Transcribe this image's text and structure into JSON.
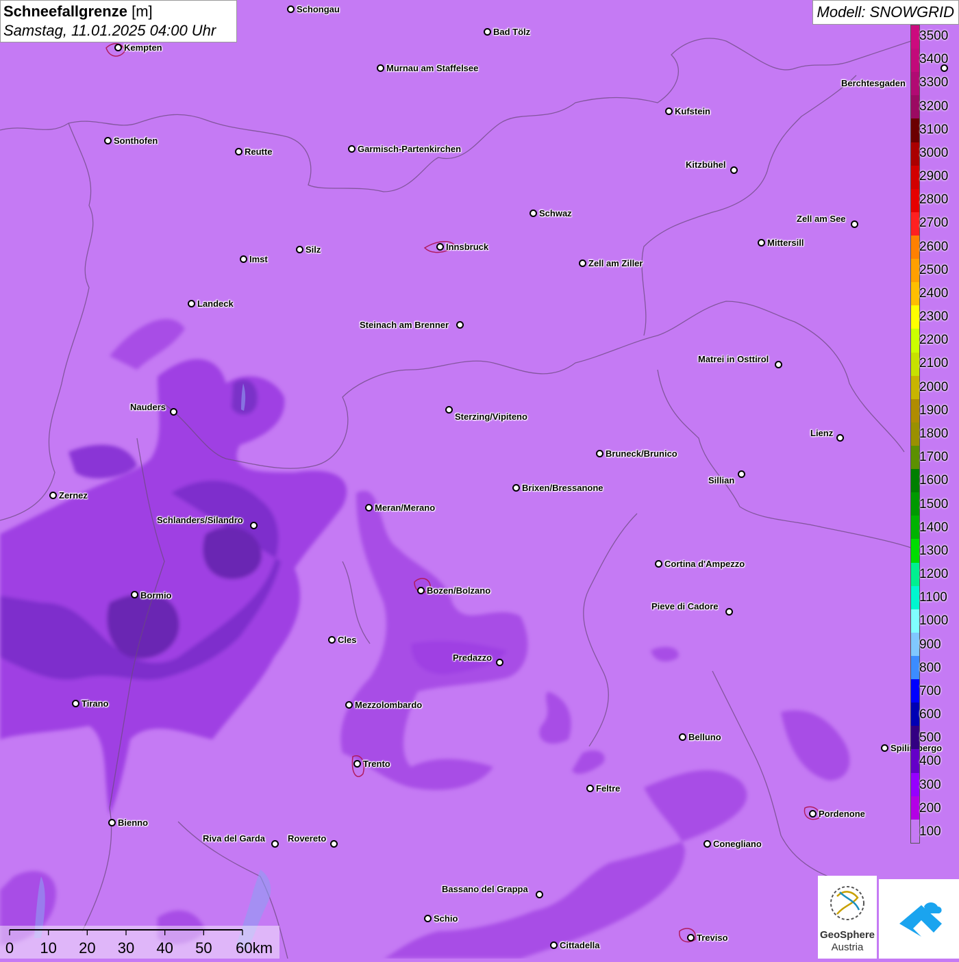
{
  "header": {
    "title": "Schneefallgrenze",
    "unit": "[m]",
    "datetime": "Samstag, 11.01.2025 04:00 Uhr"
  },
  "model": {
    "label": "Modell: SNOWGRID"
  },
  "legend": {
    "labels": [
      "3500",
      "3400",
      "3300",
      "3200",
      "3100",
      "3000",
      "2900",
      "2800",
      "2700",
      "2600",
      "2500",
      "2400",
      "2300",
      "2200",
      "2100",
      "2000",
      "1900",
      "1800",
      "1700",
      "1600",
      "1500",
      "1400",
      "1300",
      "1200",
      "1100",
      "1000",
      "900",
      "800",
      "700",
      "600",
      "500",
      "400",
      "300",
      "200",
      "100"
    ],
    "colors": [
      "#cc0a7e",
      "#c20a7a",
      "#b10a73",
      "#9b0a62",
      "#6b0000",
      "#aa0000",
      "#d20000",
      "#e60000",
      "#ff2020",
      "#ff8000",
      "#ff9f00",
      "#ffbe00",
      "#ffff00",
      "#ccff00",
      "#c7e100",
      "#c8b400",
      "#b08c00",
      "#9a9000",
      "#5c9000",
      "#007f00",
      "#009900",
      "#00b300",
      "#00dd00",
      "#00f090",
      "#00f7d0",
      "#80ffff",
      "#80c8ff",
      "#3c8cff",
      "#0000ff",
      "#0000b4",
      "#320082",
      "#6400c8",
      "#9600ff",
      "#b400e6",
      "#c57af4"
    ]
  },
  "cities": [
    {
      "name": "Schongau"
    },
    {
      "name": "Bad Tölz"
    },
    {
      "name": "Kempten"
    },
    {
      "name": "Murnau am Staffelsee"
    },
    {
      "name": "Berchtesgaden"
    },
    {
      "name": "Kufstein"
    },
    {
      "name": "Sonthofen"
    },
    {
      "name": "Reutte"
    },
    {
      "name": "Garmisch-Partenkirchen"
    },
    {
      "name": "Kitzbühel"
    },
    {
      "name": "Schwaz"
    },
    {
      "name": "Zell am See"
    },
    {
      "name": "Mittersill"
    },
    {
      "name": "Innsbruck"
    },
    {
      "name": "Imst"
    },
    {
      "name": "Silz"
    },
    {
      "name": "Zell am Ziller"
    },
    {
      "name": "Landeck"
    },
    {
      "name": "Steinach am Brenner"
    },
    {
      "name": "Matrei in Osttirol"
    },
    {
      "name": "Nauders"
    },
    {
      "name": "Sterzing/Vipiteno"
    },
    {
      "name": "Lienz"
    },
    {
      "name": "Bruneck/Brunico"
    },
    {
      "name": "Sillian"
    },
    {
      "name": "Zernez"
    },
    {
      "name": "Brixen/Bressanone"
    },
    {
      "name": "Meran/Merano"
    },
    {
      "name": "Schlanders/Silandro"
    },
    {
      "name": "Cortina d'Ampezzo"
    },
    {
      "name": "Bozen/Bolzano"
    },
    {
      "name": "Bormio"
    },
    {
      "name": "Pieve di Cadore"
    },
    {
      "name": "Cles"
    },
    {
      "name": "Predazzo"
    },
    {
      "name": "Tirano"
    },
    {
      "name": "Mezzolombardo"
    },
    {
      "name": "Belluno"
    },
    {
      "name": "Spilimbergo"
    },
    {
      "name": "Trento"
    },
    {
      "name": "Feltre"
    },
    {
      "name": "Pordenone"
    },
    {
      "name": "Bienno"
    },
    {
      "name": "Riva del Garda"
    },
    {
      "name": "Rovereto"
    },
    {
      "name": "Conegliano"
    },
    {
      "name": "Bassano del Grappa"
    },
    {
      "name": "Schio"
    },
    {
      "name": "Treviso"
    },
    {
      "name": "Cittadella"
    }
  ],
  "scale": {
    "ticks": [
      "0",
      "10",
      "20",
      "30",
      "40",
      "50",
      "60km"
    ]
  },
  "logos": {
    "geosphere_line1": "GeoSphere",
    "geosphere_line2": "Austria"
  }
}
